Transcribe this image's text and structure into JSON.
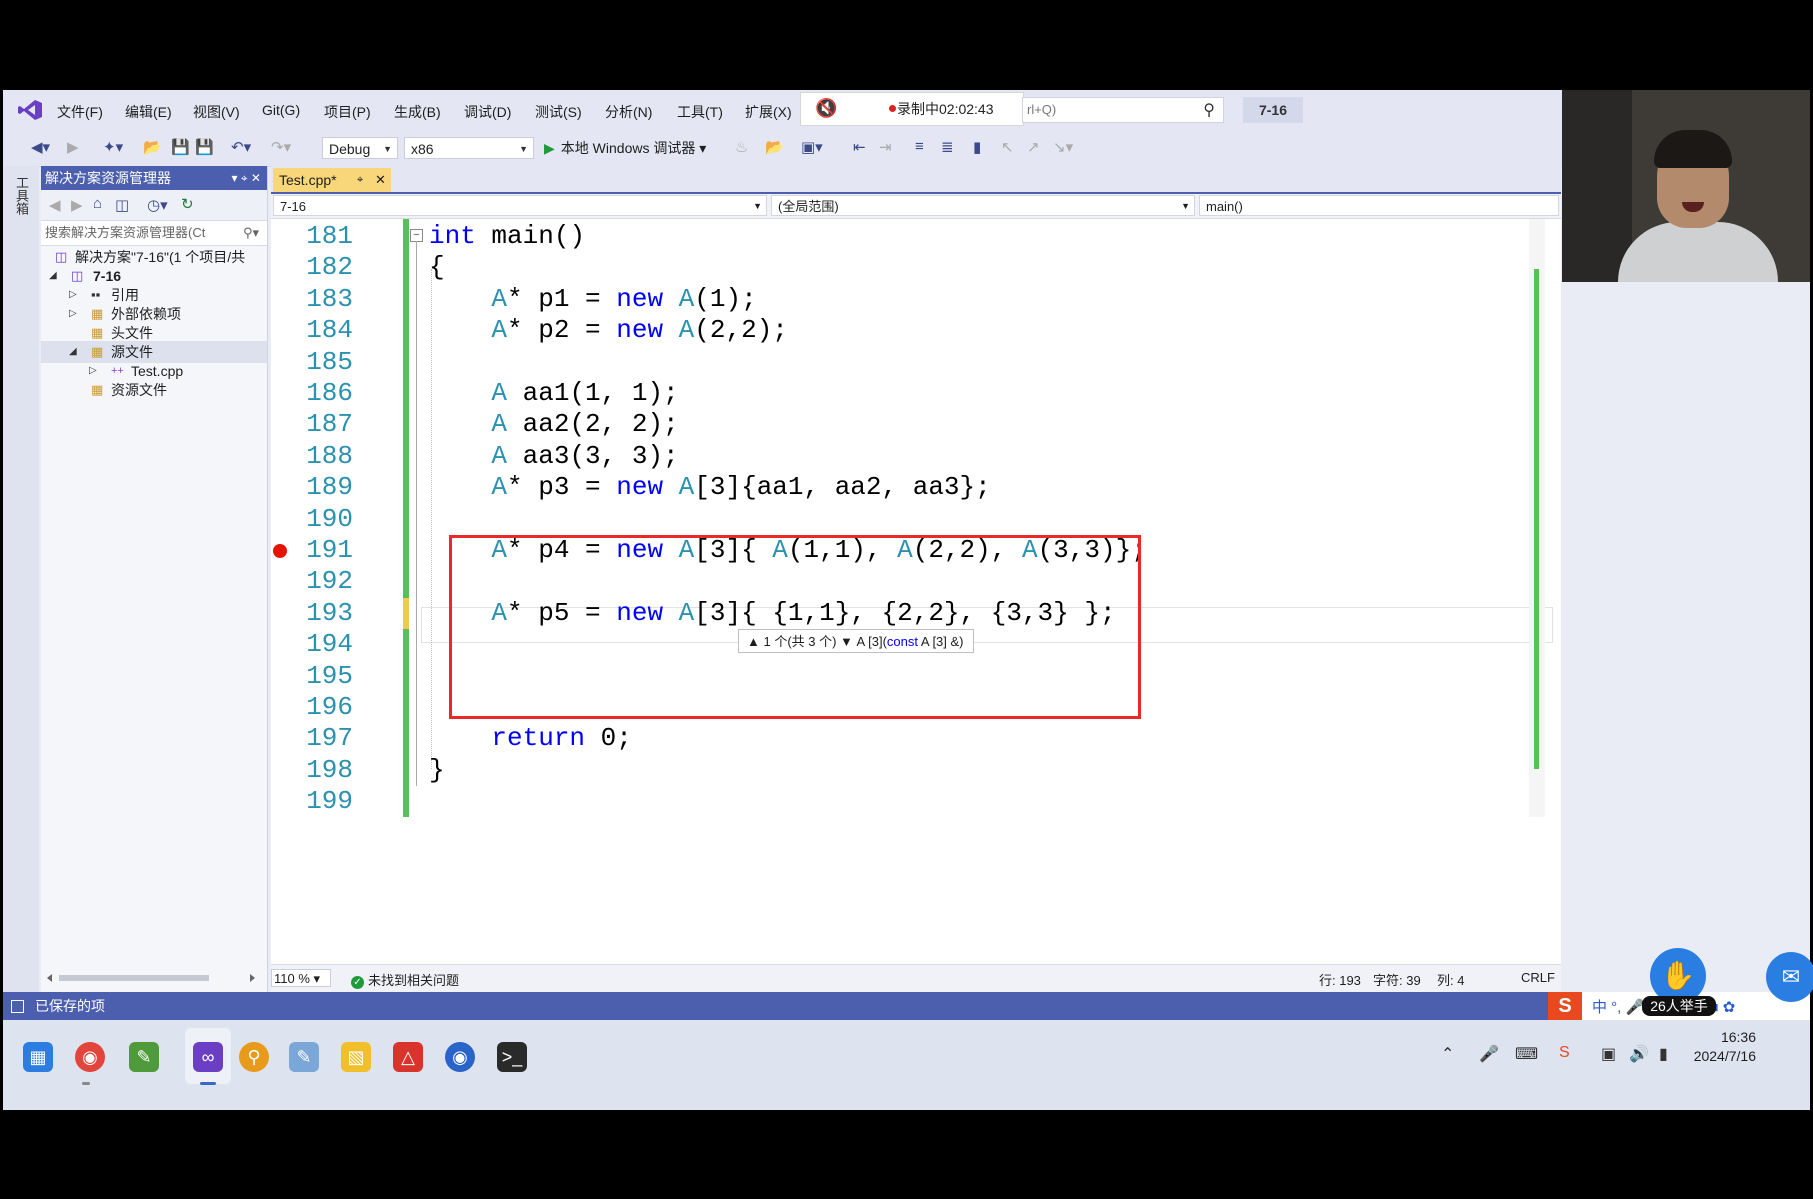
{
  "menu": {
    "items": [
      "文件(F)",
      "编辑(E)",
      "视图(V)",
      "Git(G)",
      "项目(P)",
      "生成(B)",
      "调试(D)",
      "测试(S)",
      "分析(N)",
      "工具(T)",
      "扩展(X)"
    ],
    "recording": "录制中02:02:43",
    "search_hint": "rl+Q)",
    "project": "7-16"
  },
  "toolbar": {
    "config": "Debug",
    "platform": "x86",
    "run_label": "本地 Windows 调试器"
  },
  "side_tab": "工具箱",
  "solution_explorer": {
    "title": "解决方案资源管理器",
    "search_placeholder": "搜索解决方案资源管理器(Ct",
    "tree": [
      {
        "label": "解决方案\"7-16\"(1 个项目/共",
        "level": 0,
        "icon": "solution-icon"
      },
      {
        "label": "7-16",
        "level": 1,
        "icon": "project-icon",
        "bold": true
      },
      {
        "label": "引用",
        "level": 2,
        "icon": "references-icon"
      },
      {
        "label": "外部依赖项",
        "level": 2,
        "icon": "folder-icon"
      },
      {
        "label": "头文件",
        "level": 2,
        "icon": "folder-icon"
      },
      {
        "label": "源文件",
        "level": 2,
        "icon": "folder-icon",
        "selected": true
      },
      {
        "label": "Test.cpp",
        "level": 3,
        "icon": "cpp-file-icon"
      },
      {
        "label": "资源文件",
        "level": 2,
        "icon": "folder-icon"
      }
    ]
  },
  "editor": {
    "tab_label": "Test.cpp*",
    "nav": {
      "project": "7-16",
      "scope": "(全局范围)",
      "member": "main()"
    },
    "breakpoint_line": 191,
    "current_line": 193,
    "lines": [
      {
        "no": "181",
        "code": "int main()"
      },
      {
        "no": "182",
        "code": "{"
      },
      {
        "no": "183",
        "code": "    A* p1 = new A(1);"
      },
      {
        "no": "184",
        "code": "    A* p2 = new A(2,2);"
      },
      {
        "no": "185",
        "code": ""
      },
      {
        "no": "186",
        "code": "    A aa1(1, 1);"
      },
      {
        "no": "187",
        "code": "    A aa2(2, 2);"
      },
      {
        "no": "188",
        "code": "    A aa3(3, 3);"
      },
      {
        "no": "189",
        "code": "    A* p3 = new A[3]{aa1, aa2, aa3};"
      },
      {
        "no": "190",
        "code": ""
      },
      {
        "no": "191",
        "code": "    A* p4 = new A[3]{ A(1,1), A(2,2), A(3,3)};"
      },
      {
        "no": "192",
        "code": ""
      },
      {
        "no": "193",
        "code": "    A* p5 = new A[3]{ {1,1}, {2,2}, {3,3} };"
      },
      {
        "no": "194",
        "code": ""
      },
      {
        "no": "195",
        "code": ""
      },
      {
        "no": "196",
        "code": ""
      },
      {
        "no": "197",
        "code": "    return 0;"
      },
      {
        "no": "198",
        "code": "}"
      },
      {
        "no": "199",
        "code": ""
      }
    ],
    "tooltip": {
      "counter": "▲ 1 个(共 3 个) ▼",
      "sig_prefix": "A [3](",
      "sig_kw": "const",
      "sig_suffix": " A [3] &)"
    },
    "zoom": "110 %",
    "issues": "未找到相关问题",
    "row": "行: 193",
    "char": "字符: 39",
    "col": "列: 4",
    "eol": "CRLF"
  },
  "status_bar": {
    "text": "已保存的项"
  },
  "overlay": {
    "raise_hand": "26人举手"
  },
  "clock": {
    "time": "16:36",
    "date": "2024/7/16"
  }
}
